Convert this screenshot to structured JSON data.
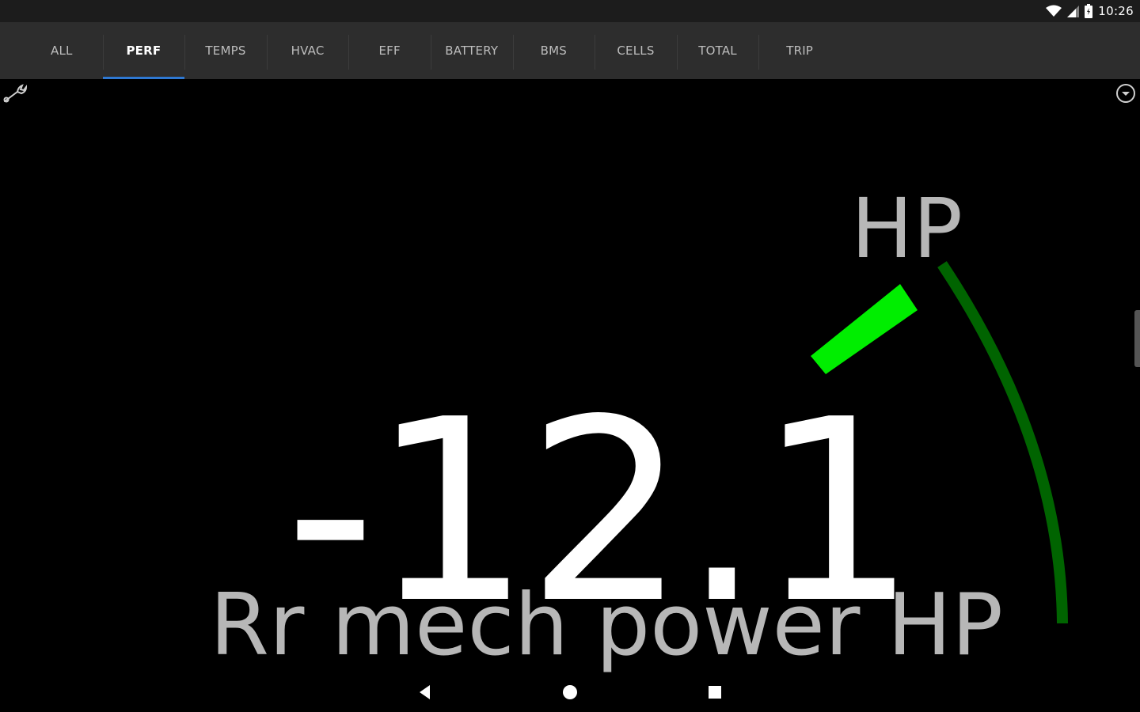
{
  "status_bar": {
    "time": "10:26",
    "icons": [
      "wifi-icon",
      "cell-signal-icon",
      "battery-icon"
    ]
  },
  "tabs": [
    {
      "label": "ALL"
    },
    {
      "label": "PERF",
      "active": true
    },
    {
      "label": "TEMPS"
    },
    {
      "label": "HVAC"
    },
    {
      "label": "EFF"
    },
    {
      "label": "BATTERY"
    },
    {
      "label": "BMS"
    },
    {
      "label": "CELLS"
    },
    {
      "label": "TOTAL"
    },
    {
      "label": "TRIP"
    }
  ],
  "toolbar": {
    "left_icon": "wrench-icon",
    "right_icon": "dropdown-circle-icon"
  },
  "gauge": {
    "unit": "HP",
    "value": "-12.1",
    "label": "Rr mech power HP",
    "colors": {
      "indicator": "#00ee00",
      "scale_arc": "#006400",
      "value_text": "#ffffff",
      "label_text": "#b7b7b7"
    }
  },
  "nav_bar": {
    "icons": [
      "back-icon",
      "home-icon",
      "recents-icon"
    ]
  }
}
